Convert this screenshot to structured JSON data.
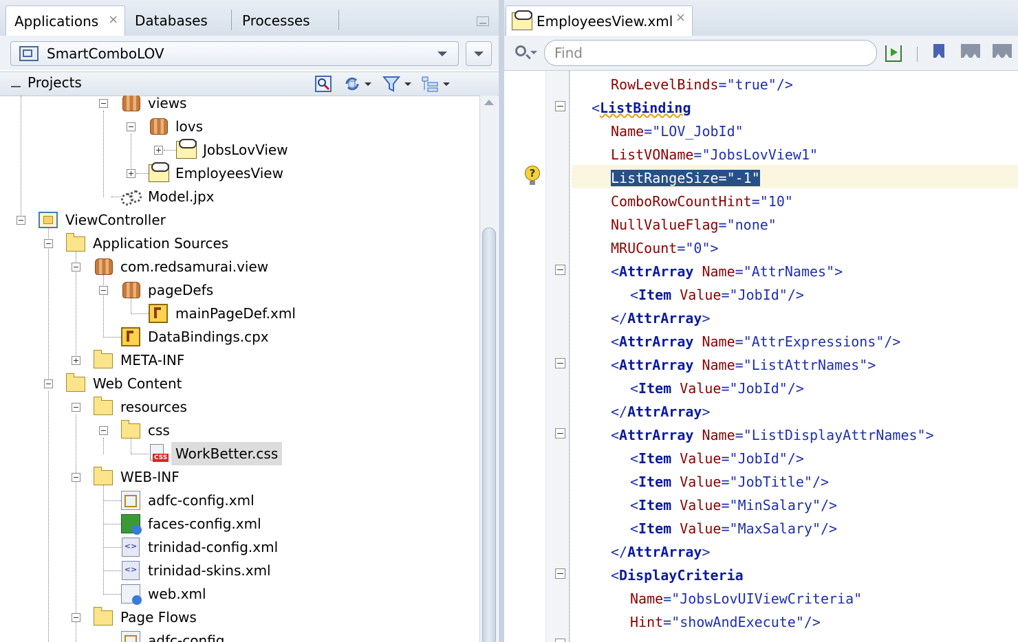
{
  "left_panel": {
    "tabs": [
      {
        "label": "Applications",
        "active": true,
        "close": "×"
      },
      {
        "label": "Databases"
      },
      {
        "label": "Processes"
      }
    ],
    "app_selector": {
      "value": "SmartComboLOV"
    },
    "projects_header": {
      "label": "Projects"
    },
    "tree": [
      {
        "label": "views",
        "icon": "package-icon",
        "expanded": true
      },
      {
        "label": "lovs",
        "icon": "package-icon",
        "expanded": true
      },
      {
        "label": "JobsLovView",
        "icon": "view-object-icon",
        "expanded": false
      },
      {
        "label": "EmployeesView",
        "icon": "view-object-icon",
        "expanded": false
      },
      {
        "label": "Model.jpx",
        "icon": "gear-icon"
      },
      {
        "label": "ViewController",
        "icon": "project-icon",
        "expanded": true
      },
      {
        "label": "Application Sources",
        "icon": "folder-icon",
        "expanded": true
      },
      {
        "label": "com.redsamurai.view",
        "icon": "package-icon",
        "expanded": true
      },
      {
        "label": "pageDefs",
        "icon": "package-icon",
        "expanded": true
      },
      {
        "label": "mainPageDef.xml",
        "icon": "pagedef-icon"
      },
      {
        "label": "DataBindings.cpx",
        "icon": "pagedef-icon"
      },
      {
        "label": "META-INF",
        "icon": "folder-icon",
        "expanded": false
      },
      {
        "label": "Web Content",
        "icon": "folder-icon",
        "expanded": true
      },
      {
        "label": "resources",
        "icon": "folder-icon",
        "expanded": true
      },
      {
        "label": "css",
        "icon": "folder-icon",
        "expanded": true
      },
      {
        "label": "WorkBetter.css",
        "icon": "css-file-icon",
        "selected": true
      },
      {
        "label": "WEB-INF",
        "icon": "folder-icon",
        "expanded": true
      },
      {
        "label": "adfc-config.xml",
        "icon": "adfc-config-icon"
      },
      {
        "label": "faces-config.xml",
        "icon": "faces-config-icon"
      },
      {
        "label": "trinidad-config.xml",
        "icon": "xml-file-icon"
      },
      {
        "label": "trinidad-skins.xml",
        "icon": "xml-file-icon"
      },
      {
        "label": "web.xml",
        "icon": "web-xml-icon"
      },
      {
        "label": "Page Flows",
        "icon": "folder-icon",
        "expanded": true
      },
      {
        "label": "adfc-config",
        "icon": "adfc-config-icon"
      }
    ]
  },
  "editor": {
    "tab": {
      "label": "EmployeesView.xml",
      "close": "×"
    },
    "find": {
      "placeholder": "Find",
      "value": ""
    },
    "lines": [
      [
        [
          "a",
          "RowLevelBinds"
        ],
        [
          "p",
          "="
        ],
        [
          "v",
          "\"true\""
        ],
        [
          "p",
          "/>"
        ]
      ],
      [
        [
          "p",
          "<"
        ],
        [
          "t",
          "ListBinding"
        ]
      ],
      [
        [
          "a",
          "Name"
        ],
        [
          "p",
          "="
        ],
        [
          "v",
          "\"LOV_JobId\""
        ]
      ],
      [
        [
          "a",
          "ListVOName"
        ],
        [
          "p",
          "="
        ],
        [
          "v",
          "\"JobsLovView1\""
        ]
      ],
      [
        [
          "hl",
          "ListRangeSize=\"-1\""
        ]
      ],
      [
        [
          "a",
          "ComboRowCountHint"
        ],
        [
          "p",
          "="
        ],
        [
          "v",
          "\"10\""
        ]
      ],
      [
        [
          "a",
          "NullValueFlag"
        ],
        [
          "p",
          "="
        ],
        [
          "v",
          "\"none\""
        ]
      ],
      [
        [
          "a",
          "MRUCount"
        ],
        [
          "p",
          "="
        ],
        [
          "v",
          "\"0\""
        ],
        [
          "p",
          ">"
        ]
      ],
      [
        [
          "p",
          "<"
        ],
        [
          "t",
          "AttrArray"
        ],
        [
          "p",
          " "
        ],
        [
          "a",
          "Name"
        ],
        [
          "p",
          "="
        ],
        [
          "v",
          "\"AttrNames\""
        ],
        [
          "p",
          ">"
        ]
      ],
      [
        [
          "p",
          "<"
        ],
        [
          "t",
          "Item"
        ],
        [
          "p",
          " "
        ],
        [
          "a",
          "Value"
        ],
        [
          "p",
          "="
        ],
        [
          "v",
          "\"JobId\""
        ],
        [
          "p",
          "/>"
        ]
      ],
      [
        [
          "p",
          "</"
        ],
        [
          "t",
          "AttrArray"
        ],
        [
          "p",
          ">"
        ]
      ],
      [
        [
          "p",
          "<"
        ],
        [
          "t",
          "AttrArray"
        ],
        [
          "p",
          " "
        ],
        [
          "a",
          "Name"
        ],
        [
          "p",
          "="
        ],
        [
          "v",
          "\"AttrExpressions\""
        ],
        [
          "p",
          "/>"
        ]
      ],
      [
        [
          "p",
          "<"
        ],
        [
          "t",
          "AttrArray"
        ],
        [
          "p",
          " "
        ],
        [
          "a",
          "Name"
        ],
        [
          "p",
          "="
        ],
        [
          "v",
          "\"ListAttrNames\""
        ],
        [
          "p",
          ">"
        ]
      ],
      [
        [
          "p",
          "<"
        ],
        [
          "t",
          "Item"
        ],
        [
          "p",
          " "
        ],
        [
          "a",
          "Value"
        ],
        [
          "p",
          "="
        ],
        [
          "v",
          "\"JobId\""
        ],
        [
          "p",
          "/>"
        ]
      ],
      [
        [
          "p",
          "</"
        ],
        [
          "t",
          "AttrArray"
        ],
        [
          "p",
          ">"
        ]
      ],
      [
        [
          "p",
          "<"
        ],
        [
          "t",
          "AttrArray"
        ],
        [
          "p",
          " "
        ],
        [
          "a",
          "Name"
        ],
        [
          "p",
          "="
        ],
        [
          "v",
          "\"ListDisplayAttrNames\""
        ],
        [
          "p",
          ">"
        ]
      ],
      [
        [
          "p",
          "<"
        ],
        [
          "t",
          "Item"
        ],
        [
          "p",
          " "
        ],
        [
          "a",
          "Value"
        ],
        [
          "p",
          "="
        ],
        [
          "v",
          "\"JobId\""
        ],
        [
          "p",
          "/>"
        ]
      ],
      [
        [
          "p",
          "<"
        ],
        [
          "t",
          "Item"
        ],
        [
          "p",
          " "
        ],
        [
          "a",
          "Value"
        ],
        [
          "p",
          "="
        ],
        [
          "v",
          "\"JobTitle\""
        ],
        [
          "p",
          "/>"
        ]
      ],
      [
        [
          "p",
          "<"
        ],
        [
          "t",
          "Item"
        ],
        [
          "p",
          " "
        ],
        [
          "a",
          "Value"
        ],
        [
          "p",
          "="
        ],
        [
          "v",
          "\"MinSalary\""
        ],
        [
          "p",
          "/>"
        ]
      ],
      [
        [
          "p",
          "<"
        ],
        [
          "t",
          "Item"
        ],
        [
          "p",
          " "
        ],
        [
          "a",
          "Value"
        ],
        [
          "p",
          "="
        ],
        [
          "v",
          "\"MaxSalary\""
        ],
        [
          "p",
          "/>"
        ]
      ],
      [
        [
          "p",
          "</"
        ],
        [
          "t",
          "AttrArray"
        ],
        [
          "p",
          ">"
        ]
      ],
      [
        [
          "p",
          "<"
        ],
        [
          "t",
          "DisplayCriteria"
        ]
      ],
      [
        [
          "a",
          "Name"
        ],
        [
          "p",
          "="
        ],
        [
          "v",
          "\"JobsLovUIViewCriteria\""
        ]
      ],
      [
        [
          "a",
          "Hint"
        ],
        [
          "p",
          "="
        ],
        [
          "v",
          "\"showAndExecute\""
        ],
        [
          "p",
          "/>"
        ]
      ]
    ]
  }
}
